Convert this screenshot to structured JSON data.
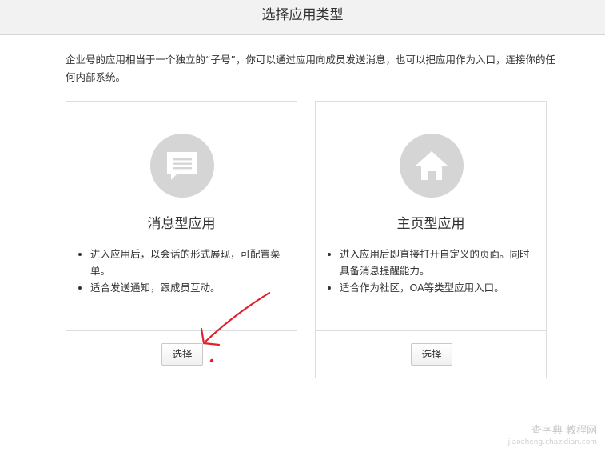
{
  "header": {
    "title": "选择应用类型"
  },
  "intro": {
    "text": "企业号的应用相当于一个独立的“子号”，你可以通过应用向成员发送消息，也可以把应用作为入口，连接你的任何内部系统。"
  },
  "cards": [
    {
      "icon": "chat-message-icon",
      "title": "消息型应用",
      "bullets": [
        "进入应用后，以会话的形式展现，可配置菜单。",
        "适合发送通知，跟成员互动。"
      ],
      "button_label": "选择"
    },
    {
      "icon": "home-icon",
      "title": "主页型应用",
      "bullets": [
        "进入应用后即直接打开自定义的页面。同时具备消息提醒能力。",
        "适合作为社区，OA等类型应用入口。"
      ],
      "button_label": "选择"
    }
  ],
  "annotation": {
    "arrow_color": "#e0202a"
  },
  "watermark": {
    "text": "查字典 教程网",
    "url_text": "jiaocheng.chazidian.com"
  }
}
